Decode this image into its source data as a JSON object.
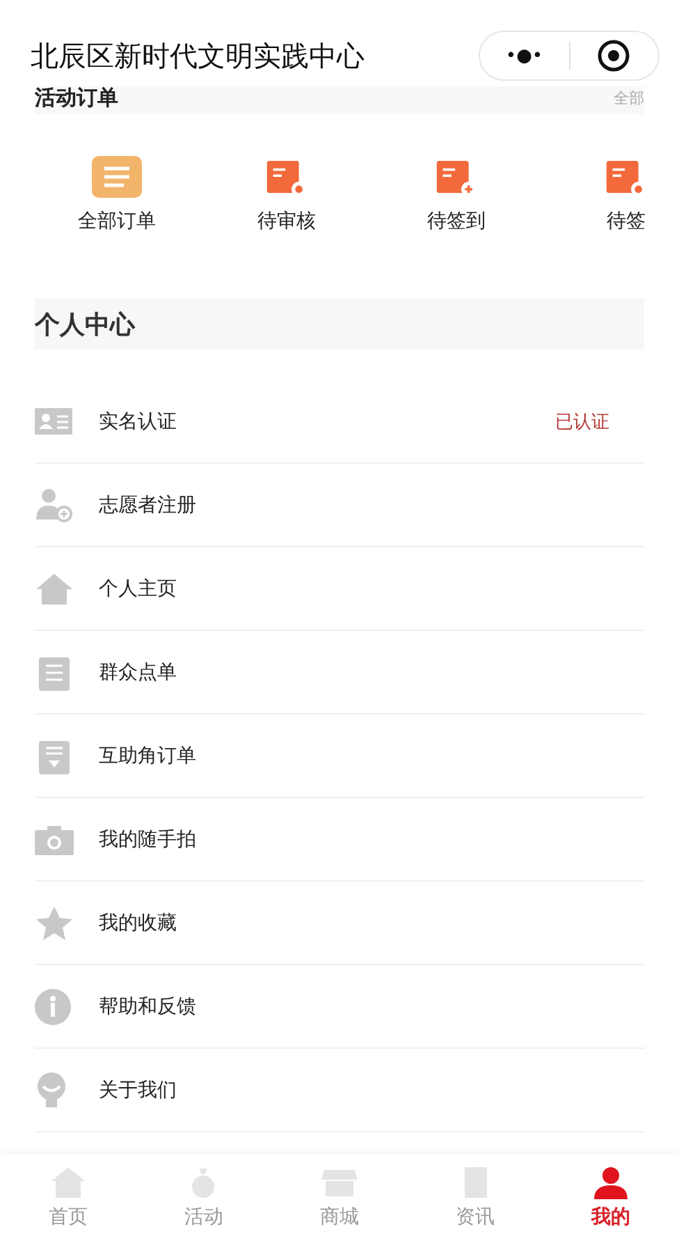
{
  "nav_bar": {
    "title": "北辰区新时代文明实践中心",
    "more": "•●•"
  },
  "order_section": {
    "title": "活动订单",
    "link": "全部",
    "items": [
      {
        "label": "全部订单",
        "kind": "all"
      },
      {
        "label": "待审核",
        "kind": "review"
      },
      {
        "label": "待签到",
        "kind": "checkin"
      },
      {
        "label": "待签",
        "kind": "checkout"
      }
    ]
  },
  "personal_center": {
    "title": "个人中心",
    "items": [
      {
        "label": "实名认证",
        "kind": "id",
        "status": "已认证"
      },
      {
        "label": "志愿者注册",
        "kind": "register"
      },
      {
        "label": "个人主页",
        "kind": "home"
      },
      {
        "label": "群众点单",
        "kind": "clipboard"
      },
      {
        "label": "互助角订单",
        "kind": "order"
      },
      {
        "label": "我的随手拍",
        "kind": "camera"
      },
      {
        "label": "我的收藏",
        "kind": "star"
      },
      {
        "label": "帮助和反馈",
        "kind": "info"
      },
      {
        "label": "关于我们",
        "kind": "about"
      }
    ]
  },
  "tab_bar": [
    {
      "label": "首页",
      "kind": "home",
      "selected": false
    },
    {
      "label": "活动",
      "kind": "bag",
      "selected": false
    },
    {
      "label": "商城",
      "kind": "shop",
      "selected": false
    },
    {
      "label": "资讯",
      "kind": "news",
      "selected": false
    },
    {
      "label": "我的",
      "kind": "me",
      "selected": true
    }
  ]
}
